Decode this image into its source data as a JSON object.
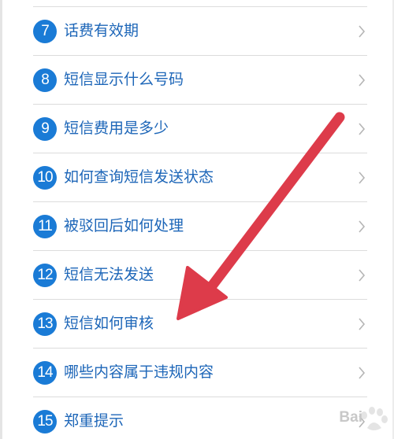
{
  "faq_list": {
    "items": [
      {
        "number": "7",
        "label": "话费有效期"
      },
      {
        "number": "8",
        "label": "短信显示什么号码"
      },
      {
        "number": "9",
        "label": "短信费用是多少"
      },
      {
        "number": "10",
        "label": "如何查询短信发送状态"
      },
      {
        "number": "11",
        "label": "被驳回后如何处理"
      },
      {
        "number": "12",
        "label": "短信无法发送"
      },
      {
        "number": "13",
        "label": "短信如何审核"
      },
      {
        "number": "14",
        "label": "哪些内容属于违规内容"
      },
      {
        "number": "15",
        "label": "郑重提示"
      }
    ],
    "chevron_icon": "chevron-right-icon"
  },
  "colors": {
    "badge": "#1a7bd6",
    "label": "#1d66b8",
    "divider": "#dcdcdc",
    "chevron": "#b5b5b5",
    "annotation_arrow": "#dd3b4a"
  },
  "watermark": {
    "text": "Bai",
    "logo": "baidu-paw-logo"
  }
}
